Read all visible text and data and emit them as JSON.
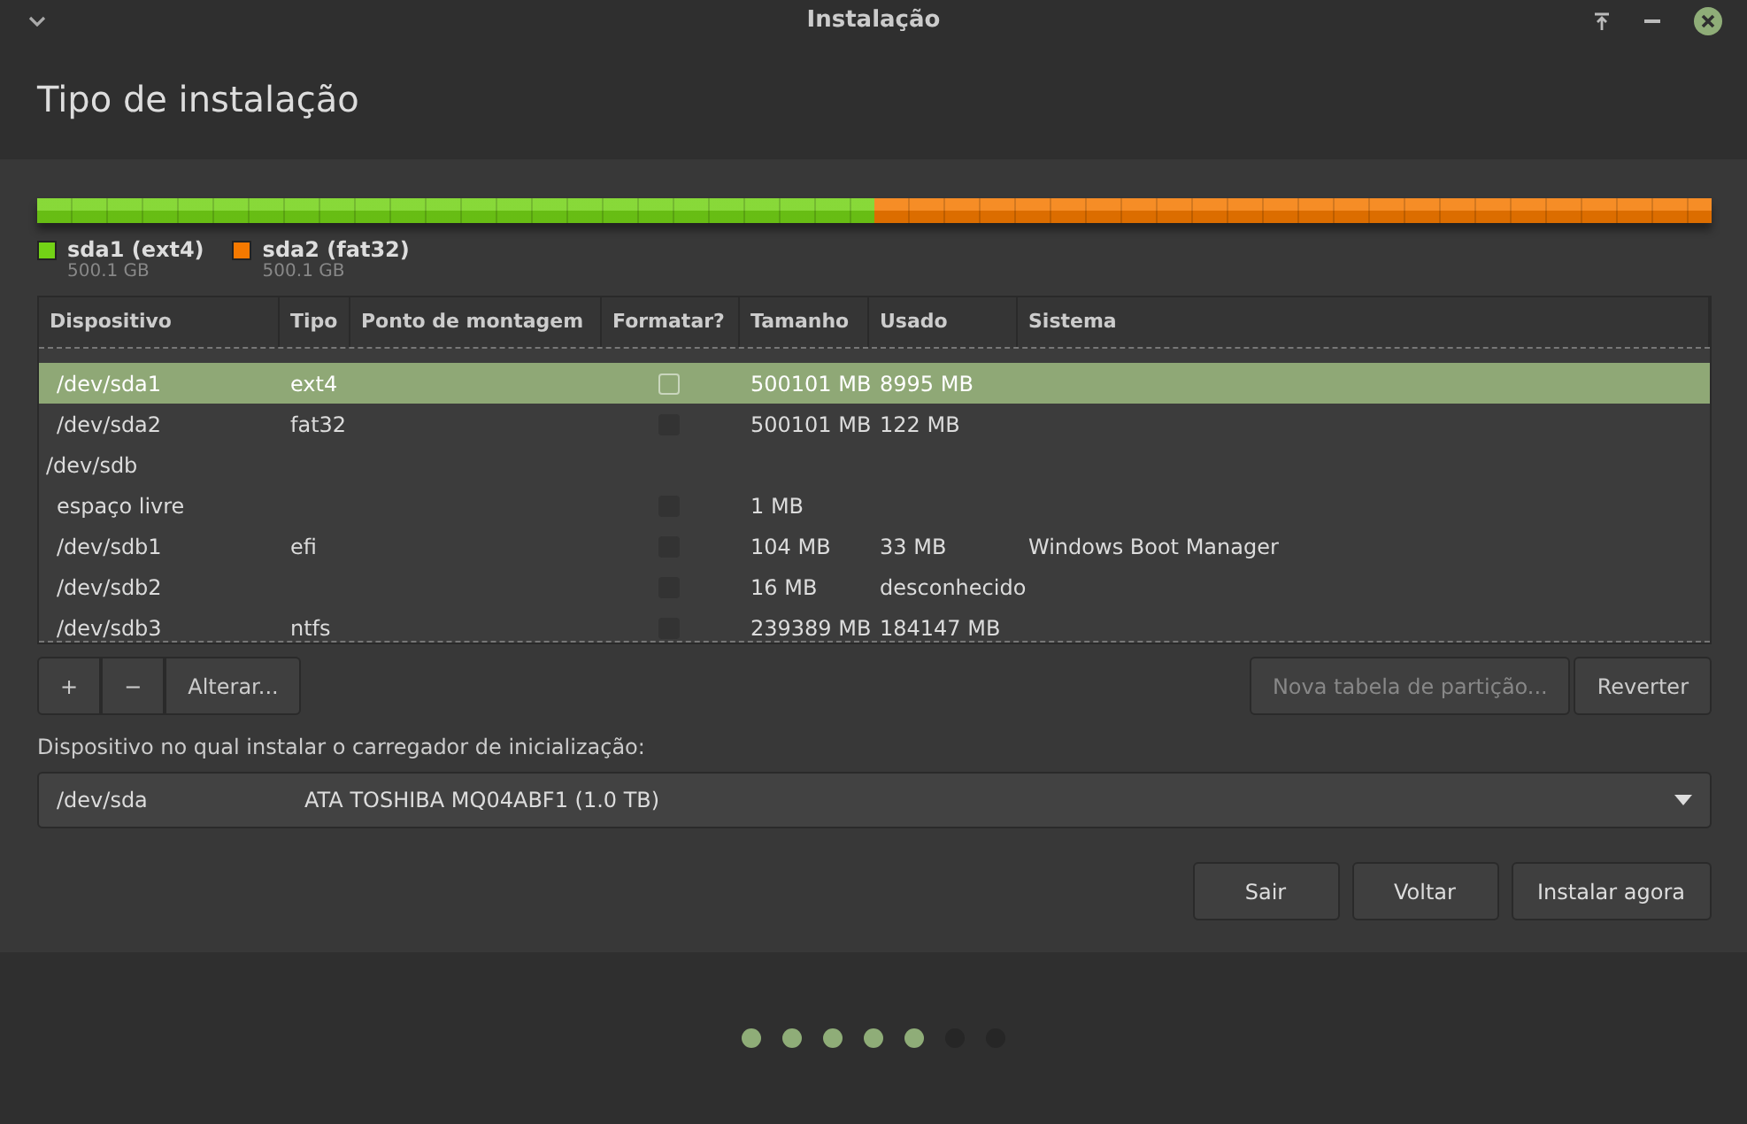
{
  "window": {
    "title": "Instalação"
  },
  "heading": "Tipo de instalação",
  "partitions": [
    {
      "name": "sda1 (ext4)",
      "size": "500.1 GB",
      "color": "#73d216",
      "level": 0.5
    },
    {
      "name": "sda2 (fat32)",
      "size": "500.1 GB",
      "color": "#f57900",
      "level": 0.5
    }
  ],
  "table": {
    "columns": [
      "Dispositivo",
      "Tipo",
      "Ponto de montagem",
      "Formatar?",
      "Tamanho",
      "Usado",
      "Sistema"
    ],
    "disks": [
      {
        "children": [
          {
            "device": "/dev/sda1",
            "type": "ext4",
            "format": false,
            "size": "500101 MB",
            "used": "8995 MB",
            "selected": true
          },
          {
            "device": "/dev/sda2",
            "type": "fat32",
            "format": false,
            "size": "500101 MB",
            "used": "122 MB",
            "selected": false
          }
        ]
      },
      {
        "device": "/dev/sdb",
        "children": [
          {
            "device": "espaço livre",
            "format": false,
            "size": "1 MB",
            "selected": false
          },
          {
            "device": "/dev/sdb1",
            "type": "efi",
            "format": false,
            "size": "104 MB",
            "used": "33 MB",
            "system": "Windows Boot Manager",
            "selected": false
          },
          {
            "device": "/dev/sdb2",
            "format": false,
            "size": "16 MB",
            "used": "desconhecido",
            "selected": false
          },
          {
            "device": "/dev/sdb3",
            "type": "ntfs",
            "format": false,
            "size": "239389 MB",
            "used": "184147 MB",
            "selected": false
          }
        ]
      }
    ]
  },
  "toolbar": [
    {
      "label": "+",
      "disabled": false
    },
    {
      "label": "−",
      "disabled": false
    },
    {
      "label": "Alterar...",
      "disabled": false
    }
  ],
  "right_buttons": [
    {
      "label": "Nova tabela de partição...",
      "disabled": true
    },
    {
      "label": "Reverter",
      "disabled": false
    }
  ],
  "bootloader": {
    "label": "Dispositivo no qual instalar o carregador de inicialização:",
    "device": "/dev/sda",
    "description": "ATA TOSHIBA MQ04ABF1 (1.0 TB)"
  },
  "buttons": [
    "Sair",
    "Voltar",
    "Instalar agora"
  ],
  "steps": [
    {
      "completed": true
    },
    {
      "completed": true
    },
    {
      "completed": true
    },
    {
      "completed": true
    },
    {
      "completed": true
    },
    {
      "completed": false
    },
    {
      "completed": false
    }
  ]
}
